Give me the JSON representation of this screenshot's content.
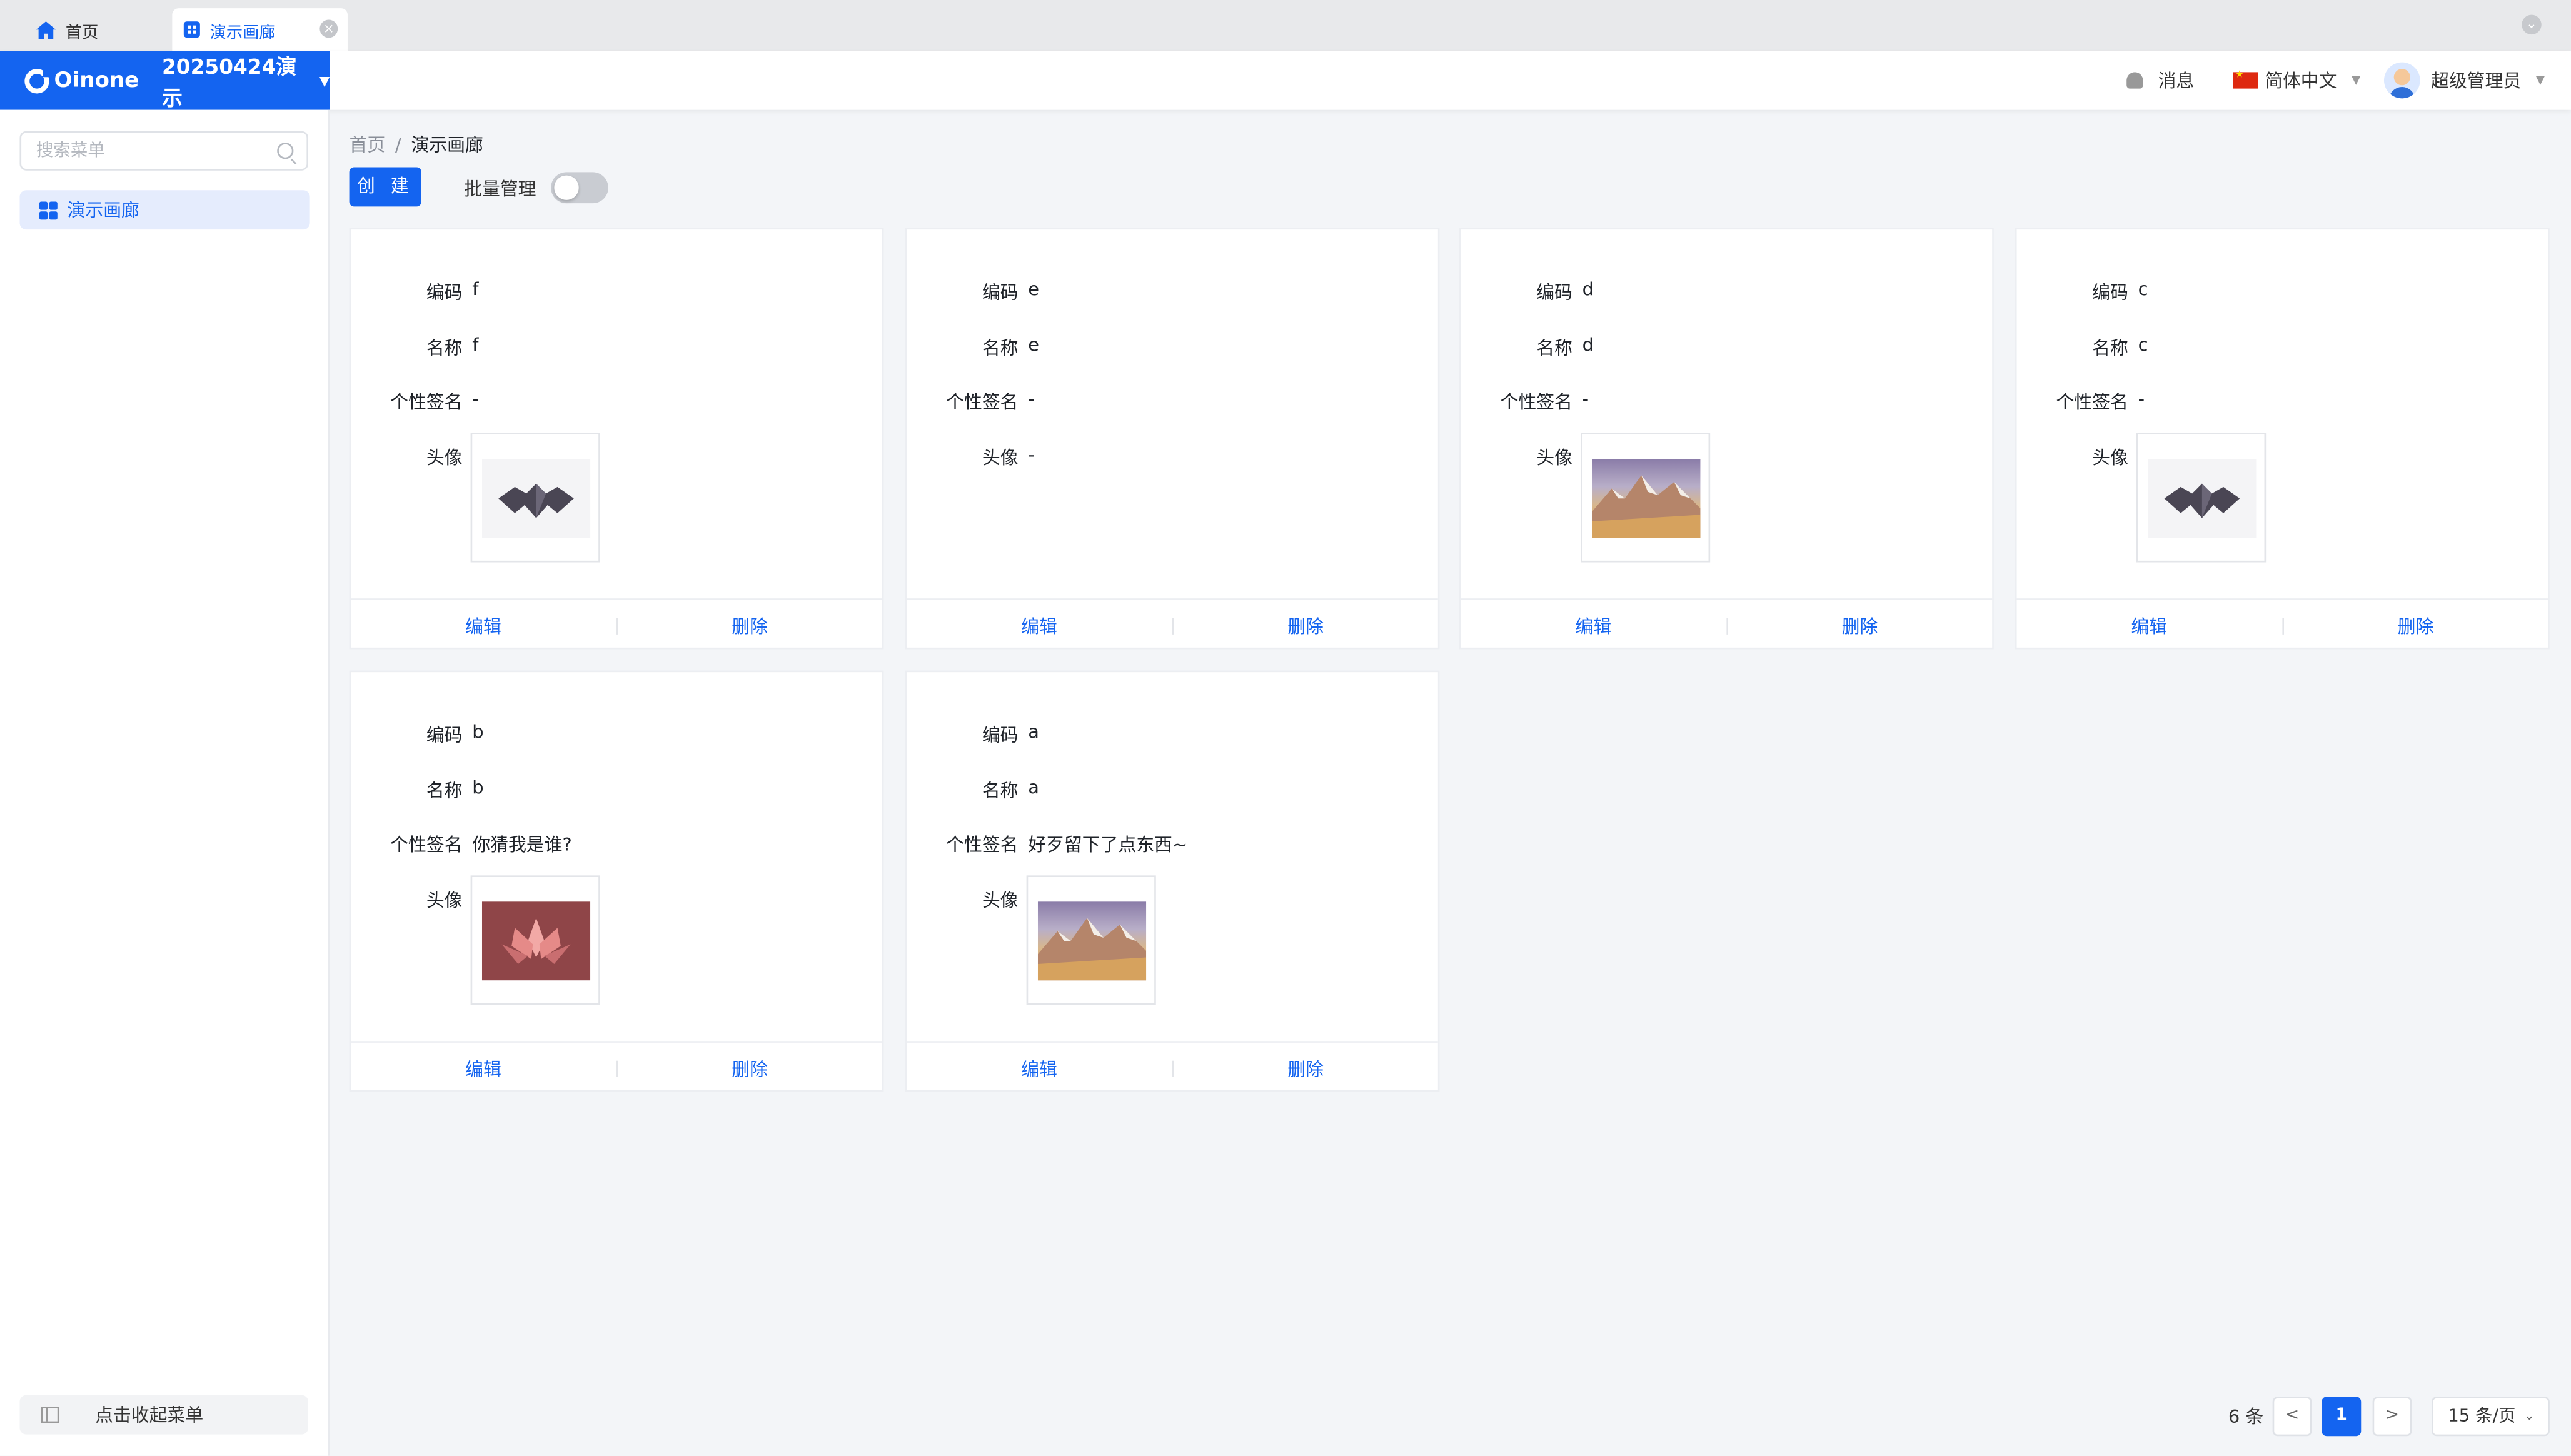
{
  "tabs": [
    {
      "label": "首页"
    },
    {
      "label": "演示画廊"
    }
  ],
  "header": {
    "brand": "Oinone",
    "project": "20250424演示",
    "message_label": "消息",
    "language_label": "简体中文",
    "user_label": "超级管理员"
  },
  "sidebar": {
    "search_placeholder": "搜索菜单",
    "items": [
      {
        "label": "演示画廊"
      }
    ],
    "collapse_label": "点击收起菜单"
  },
  "breadcrumb": {
    "home": "首页",
    "separator": "/",
    "current": "演示画廊"
  },
  "toolbar": {
    "create_label": "创 建",
    "batch_label": "批量管理",
    "batch_on": false
  },
  "card_labels": {
    "code": "编码",
    "name": "名称",
    "signature": "个性签名",
    "avatar": "头像",
    "edit": "编辑",
    "delete": "删除"
  },
  "cards": [
    {
      "code": "f",
      "name": "f",
      "signature": "-",
      "avatar": "bat",
      "avatar_text": ""
    },
    {
      "code": "e",
      "name": "e",
      "signature": "-",
      "avatar": "",
      "avatar_text": "-"
    },
    {
      "code": "d",
      "name": "d",
      "signature": "-",
      "avatar": "mountain",
      "avatar_text": ""
    },
    {
      "code": "c",
      "name": "c",
      "signature": "-",
      "avatar": "bat",
      "avatar_text": ""
    },
    {
      "code": "b",
      "name": "b",
      "signature": "你猜我是谁?",
      "avatar": "lotus",
      "avatar_text": ""
    },
    {
      "code": "a",
      "name": "a",
      "signature": "好歹留下了点东西~",
      "avatar": "mountain",
      "avatar_text": ""
    }
  ],
  "pagination": {
    "total": "6 条",
    "prev": "<",
    "current": "1",
    "next": ">",
    "page_size": "15 条/页"
  },
  "colors": {
    "accent": "#1464f0",
    "bg": "#f3f5f8"
  }
}
